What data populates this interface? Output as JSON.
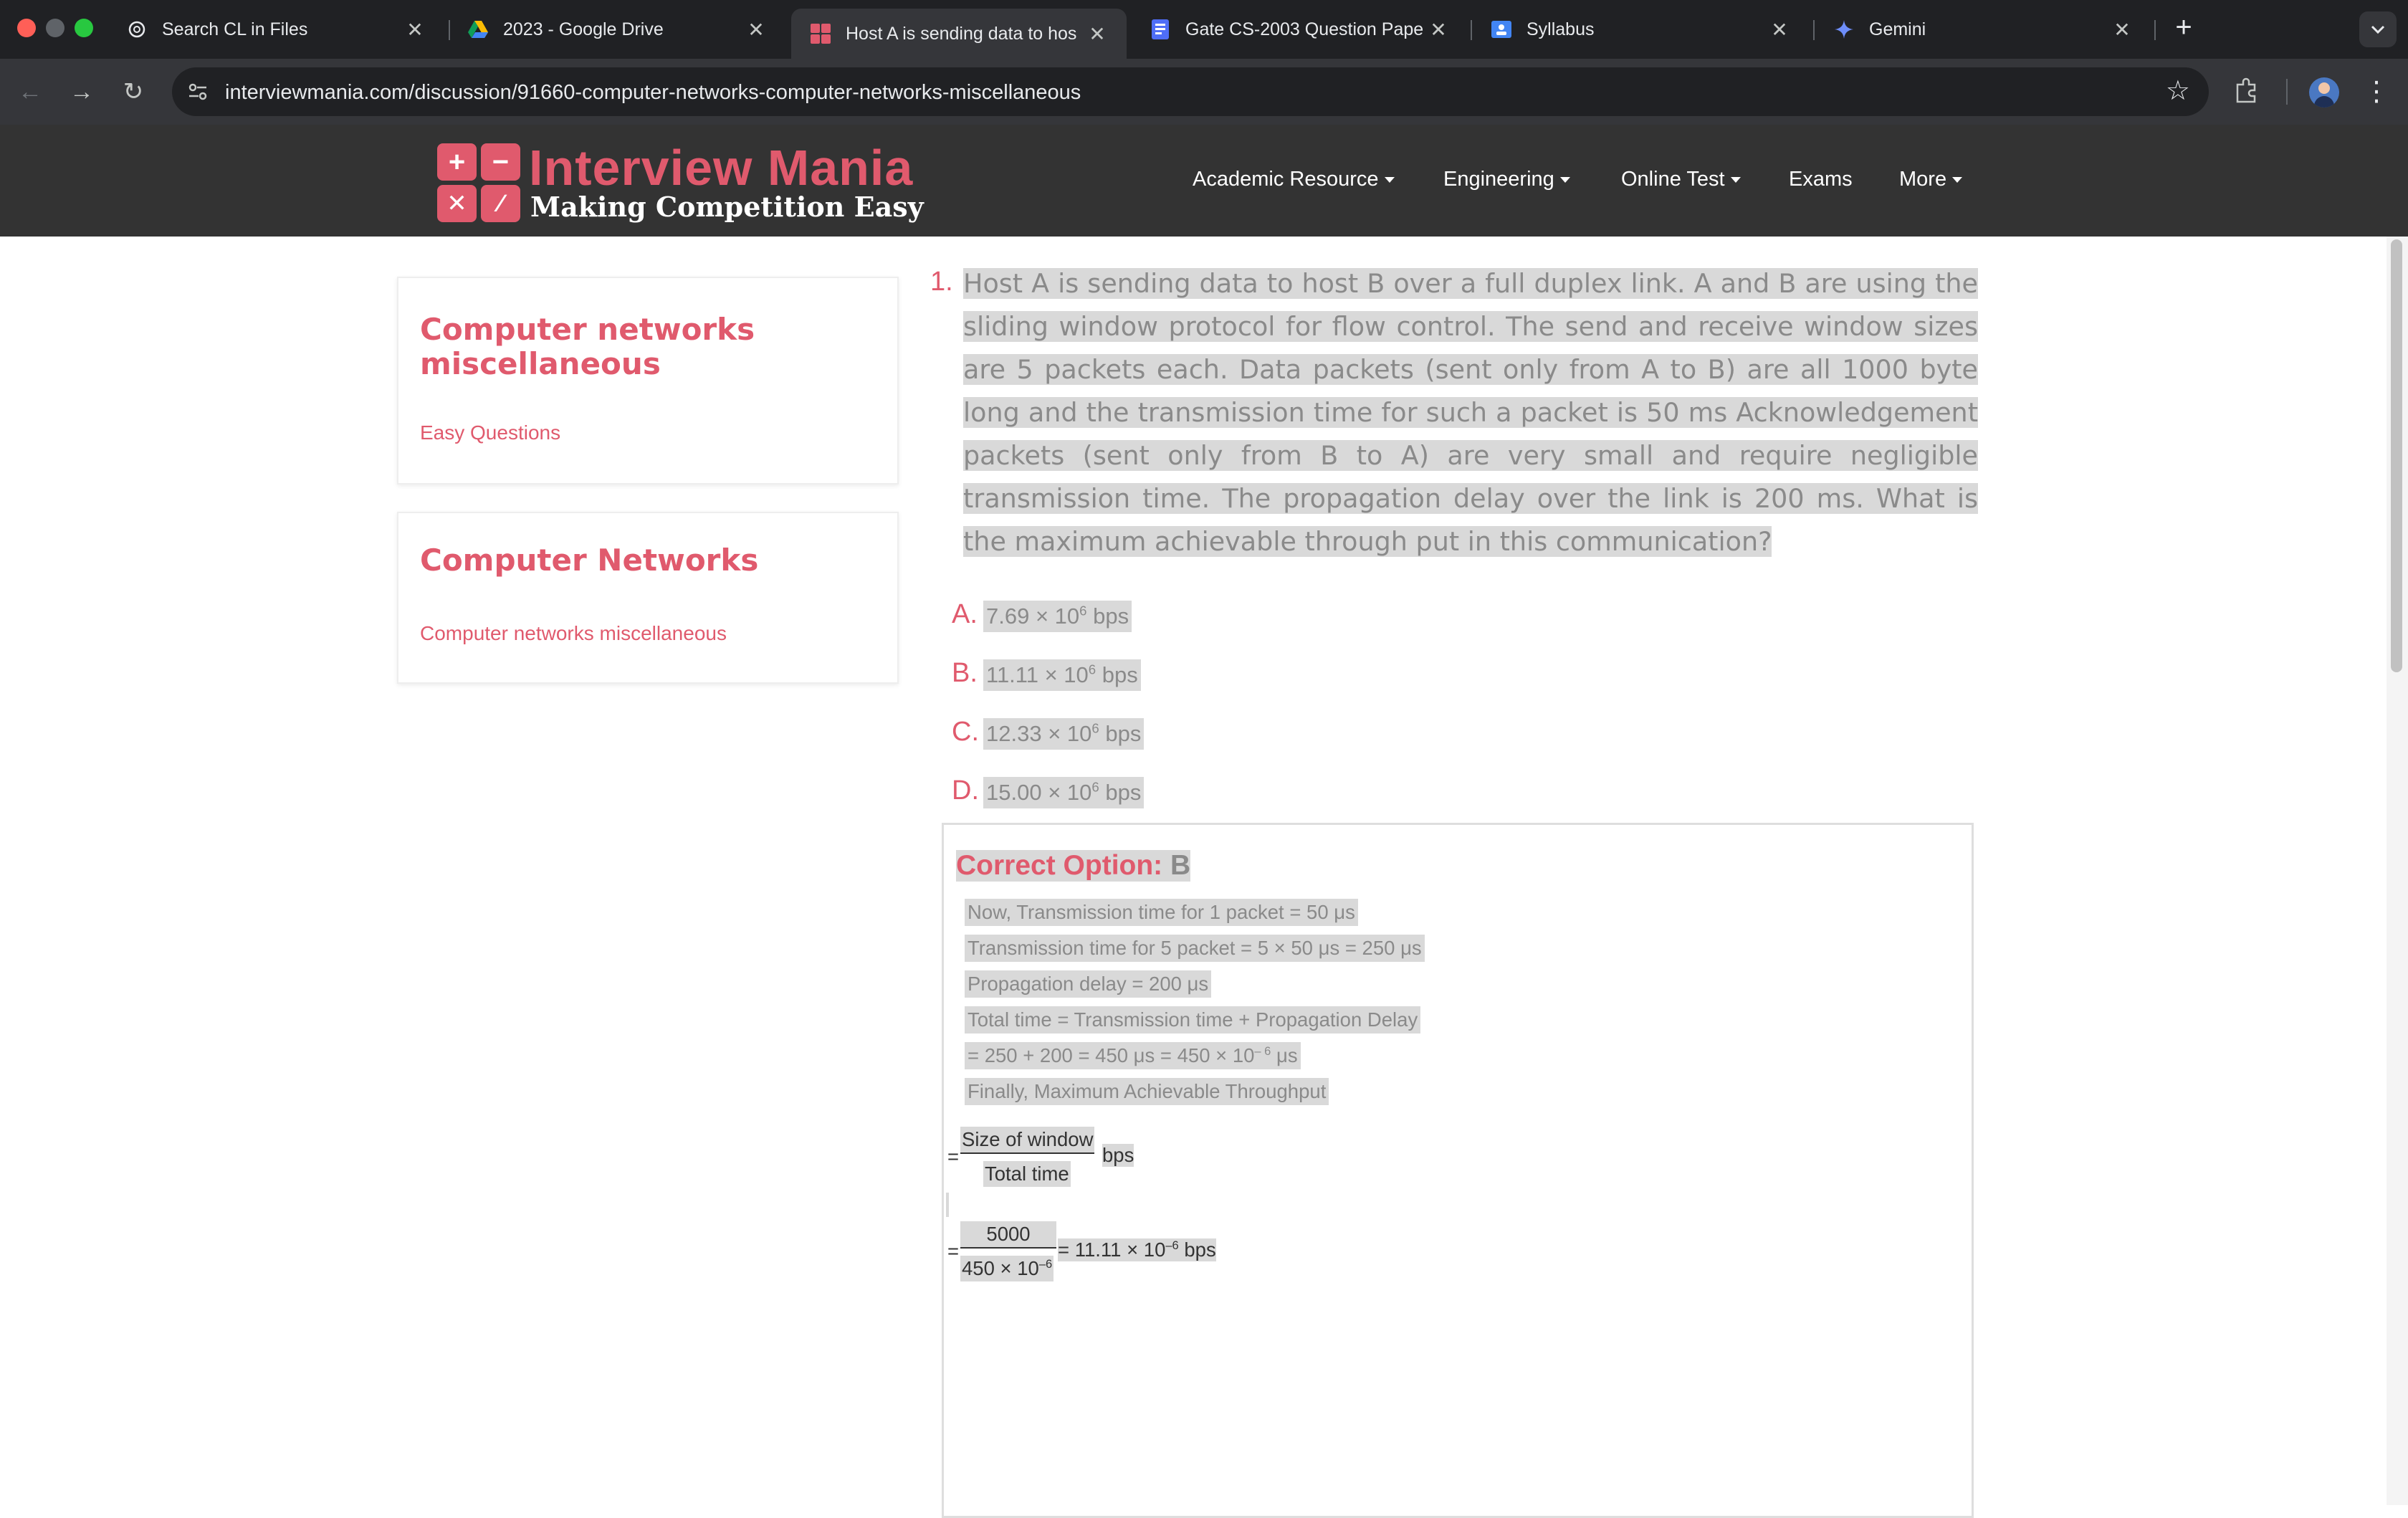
{
  "browser": {
    "tabs": [
      {
        "title": "Search CL in Files",
        "icon": "openai-icon"
      },
      {
        "title": "2023 - Google Drive",
        "icon": "google-drive-icon"
      },
      {
        "title": "Host A is sending data to hos",
        "icon": "interviewmania-icon",
        "active": true
      },
      {
        "title": "Gate CS-2003 Question Pape",
        "icon": "document-icon"
      },
      {
        "title": "Syllabus",
        "icon": "classroom-icon"
      },
      {
        "title": "Gemini",
        "icon": "gemini-icon"
      }
    ],
    "url": "interviewmania.com/discussion/91660-computer-networks-computer-networks-miscellaneous"
  },
  "site": {
    "logo_title": "Interview Mania",
    "logo_tagline": "Making Competition Easy",
    "nav": [
      {
        "label": "Academic Resource",
        "dropdown": true
      },
      {
        "label": "Engineering",
        "dropdown": true
      },
      {
        "label": "Online Test",
        "dropdown": true
      },
      {
        "label": "Exams",
        "dropdown": false
      },
      {
        "label": "More",
        "dropdown": true
      }
    ],
    "accent_color": "#e05a6d"
  },
  "sidebar": {
    "card1": {
      "title": "Computer networks miscellaneous",
      "link": "Easy Questions"
    },
    "card2": {
      "title": "Computer Networks",
      "link": "Computer networks miscellaneous"
    }
  },
  "question": {
    "number": "1.",
    "text": "Host A is sending data to host B over a full duplex link. A and B are using the sliding window protocol for flow control. The send and receive window sizes are 5 packets each. Data packets (sent only from A to B) are all 1000 byte long and the transmission time for such a packet is 50 ms Acknowledgement packets (sent only from B to A) are very small and require negligible transmission time. The propagation delay over the link is 200 ms. What is the maximum achievable through put in this communication?",
    "options": [
      {
        "letter": "A.",
        "mantissa": "7.69 × 10",
        "exp": "6",
        "unit": " bps"
      },
      {
        "letter": "B.",
        "mantissa": "11.11 × 10",
        "exp": "6",
        "unit": " bps"
      },
      {
        "letter": "C.",
        "mantissa": "12.33 × 10",
        "exp": "6",
        "unit": " bps"
      },
      {
        "letter": "D.",
        "mantissa": "15.00 × 10",
        "exp": "6",
        "unit": " bps"
      }
    ]
  },
  "answer": {
    "label": "Correct Option:",
    "value": "B",
    "lines": [
      "Now, Transmission time for 1 packet = 50 μs",
      "Transmission time for 5 packet = 5 × 50 μs = 250 μs",
      "Propagation delay = 200 μs",
      "Total time = Transmission time + Propagation Delay",
      "Finally, Maximum Achievable Throughput"
    ],
    "line5_prefix": "= 250 + 200 = 450 μs = 450 × 10",
    "line5_exp": "– 6",
    "line5_unit": " μs",
    "frac1": {
      "prefix": "=",
      "num": "Size of window",
      "den": "Total time",
      "suffix": "bps"
    },
    "frac2": {
      "prefix": "=",
      "num": "5000",
      "den_base": "450 × 10",
      "den_exp": "–6",
      "result_base": "= 11.11 × 10",
      "result_exp": "–6",
      "result_unit": " bps"
    }
  }
}
